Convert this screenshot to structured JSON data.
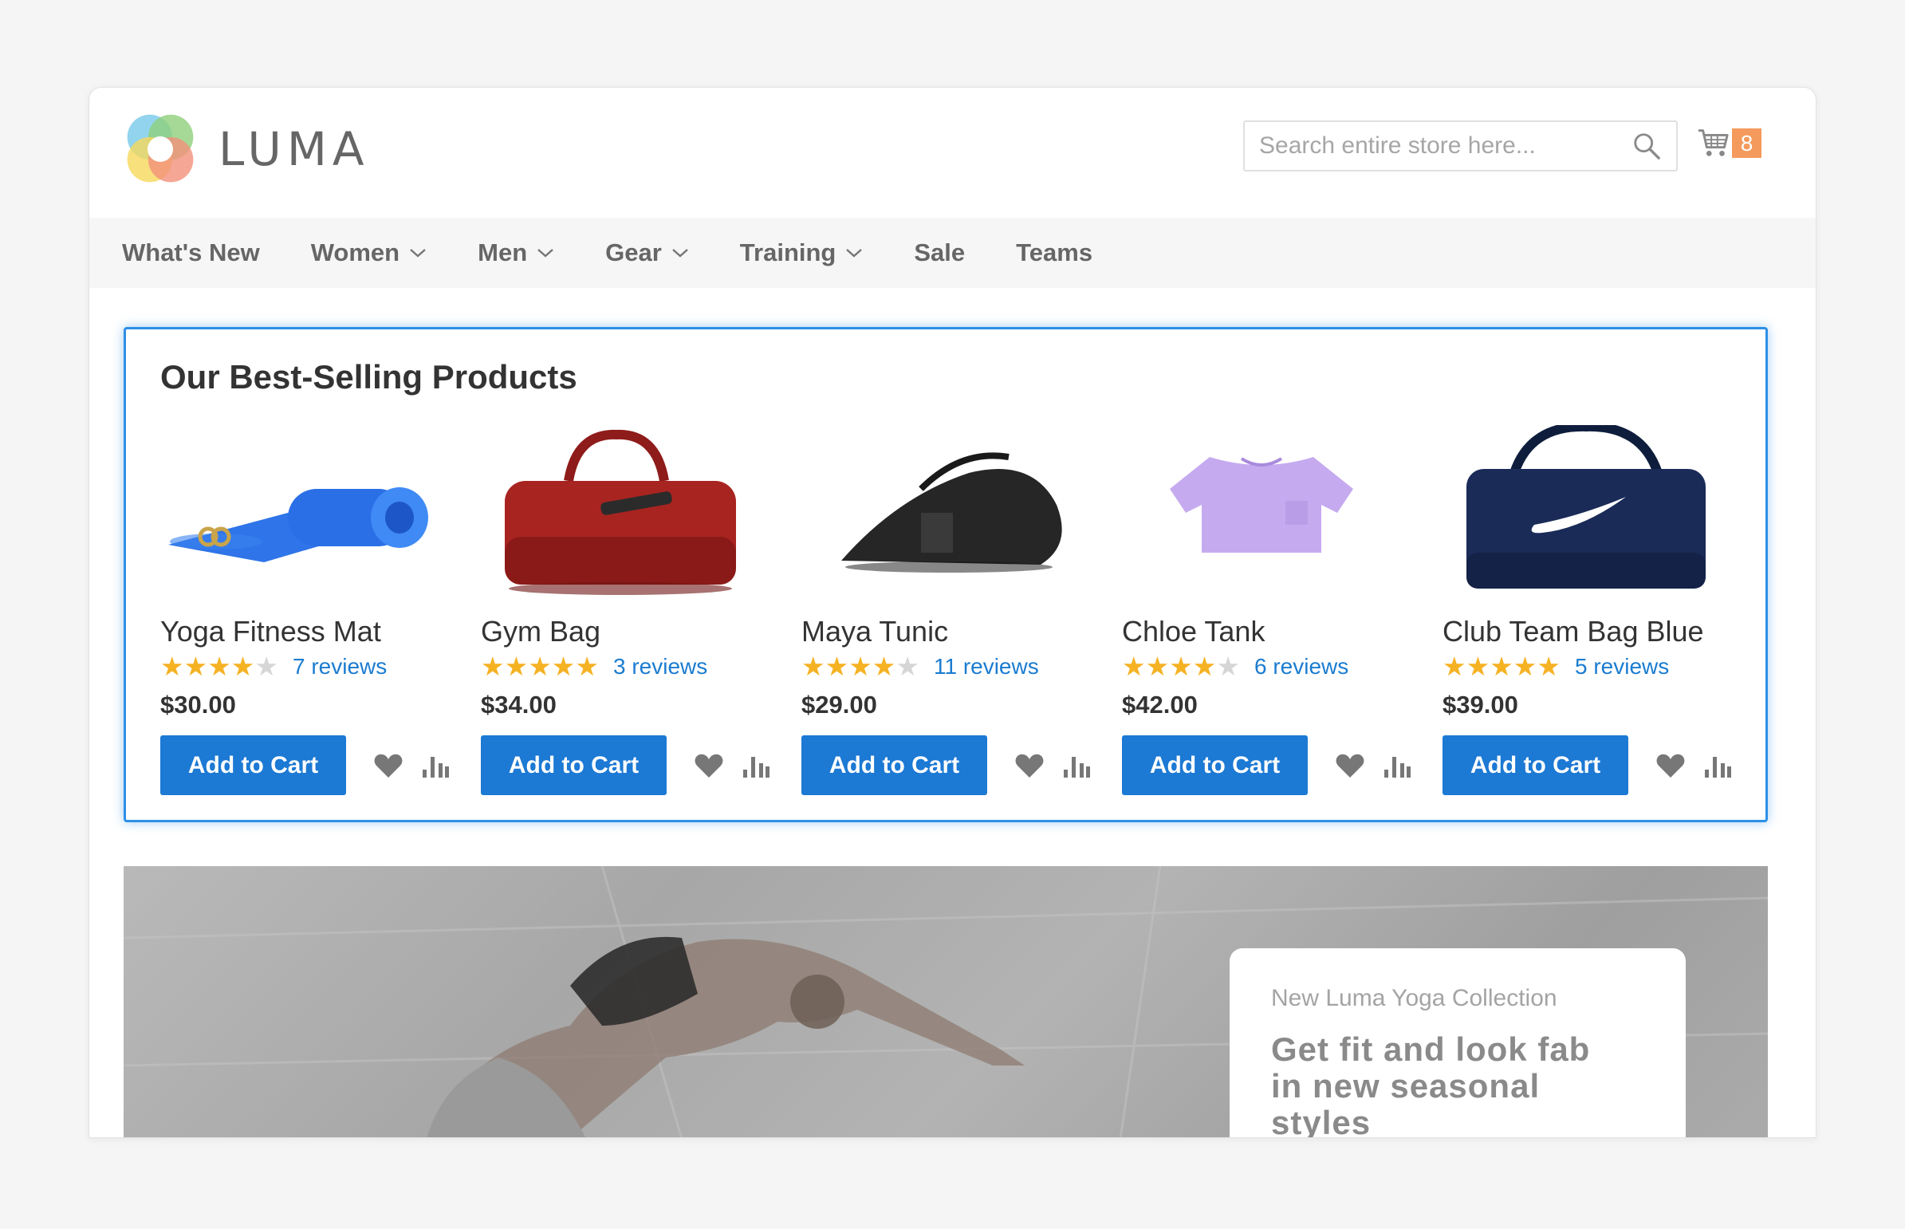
{
  "header": {
    "logo_text": "LUMA",
    "search_placeholder": "Search entire store here...",
    "cart_count": "8"
  },
  "nav": {
    "items": [
      {
        "label": "What's New",
        "has_dropdown": false
      },
      {
        "label": "Women",
        "has_dropdown": true
      },
      {
        "label": "Men",
        "has_dropdown": true
      },
      {
        "label": "Gear",
        "has_dropdown": true
      },
      {
        "label": "Training",
        "has_dropdown": true
      },
      {
        "label": "Sale",
        "has_dropdown": false
      },
      {
        "label": "Teams",
        "has_dropdown": false
      }
    ]
  },
  "best_sellers": {
    "title": "Our Best-Selling Products",
    "add_to_cart_label": "Add to Cart",
    "products": [
      {
        "name": "Yoga Fitness Mat",
        "rating": 4,
        "reviews": "7 reviews",
        "price": "$30.00",
        "image": "yoga-mat"
      },
      {
        "name": "Gym Bag",
        "rating": 5,
        "reviews": "3 reviews",
        "price": "$34.00",
        "image": "red-duffel-bag"
      },
      {
        "name": "Maya Tunic",
        "rating": 4,
        "reviews": "11 reviews",
        "price": "$29.00",
        "image": "black-racket-bag"
      },
      {
        "name": "Chloe Tank",
        "rating": 4,
        "reviews": "6 reviews",
        "price": "$42.00",
        "image": "lavender-crop-top"
      },
      {
        "name": "Club Team Bag Blue",
        "rating": 5,
        "reviews": "5 reviews",
        "price": "$39.00",
        "image": "navy-team-bag"
      }
    ]
  },
  "hero": {
    "eyebrow": "New Luma Yoga Collection",
    "headline_line1": "Get fit and look fab",
    "headline_line2": "in new seasonal styles"
  },
  "colors": {
    "accent": "#1c79d4",
    "highlight_border": "#2d8fe6",
    "star": "#f5b223",
    "cart_badge": "#f49a5c",
    "review_link": "#1b7cd0"
  }
}
